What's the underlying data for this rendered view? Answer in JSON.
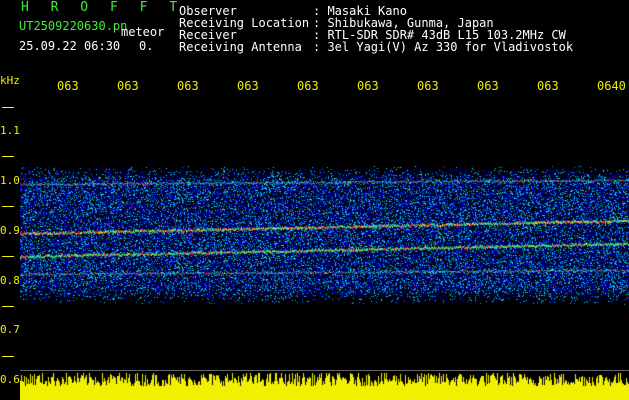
{
  "header": {
    "brand": "HROFFT",
    "filename": "UT2509220630.pn",
    "meteor_label": "meteor",
    "datetime": "25.09.22 06:30",
    "meteor_count": "0."
  },
  "info": [
    {
      "key": "Observer",
      "value": ": Masaki Kano"
    },
    {
      "key": "Receiving Location",
      "value": ": Shibukawa, Gunma, Japan"
    },
    {
      "key": "Receiver",
      "value": ": RTL-SDR SDR# 43dB L15 103.2MHz CW"
    },
    {
      "key": "Receiving Antenna",
      "value": ": 3el Yagi(V) Az 330 for Vladivostok"
    }
  ],
  "axis": {
    "y_unit": "kHz",
    "y_ticks": [
      "1.1",
      "1.0",
      "0.9",
      "0.8",
      "0.7",
      "0.6"
    ],
    "y_values": [
      1.1,
      1.0,
      0.9,
      0.8,
      0.7,
      0.6
    ],
    "x_ticks": [
      "063",
      "063",
      "063",
      "063",
      "063",
      "063",
      "063",
      "063",
      "063",
      "0640"
    ]
  },
  "colors": {
    "axis_text": "#f0f000",
    "brand": "#3cf03c",
    "header_text": "#ffffff",
    "noise_bar": "#f0f000"
  }
}
